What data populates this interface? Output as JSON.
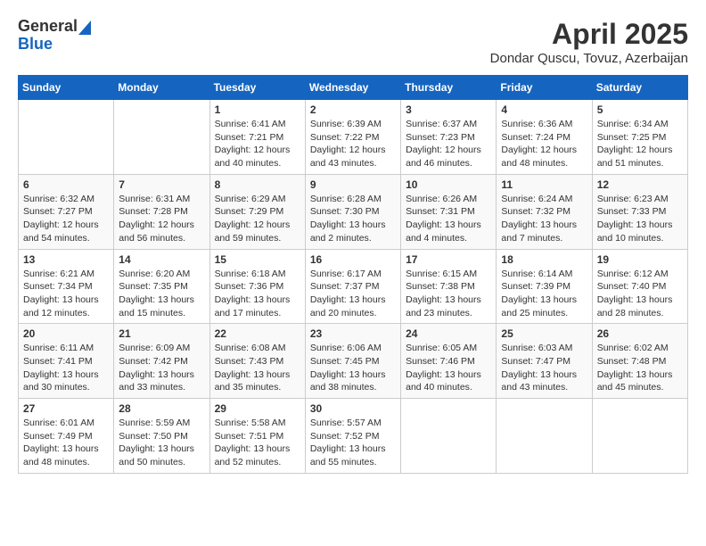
{
  "header": {
    "logo_general": "General",
    "logo_blue": "Blue",
    "title": "April 2025",
    "location": "Dondar Quscu, Tovuz, Azerbaijan"
  },
  "weekdays": [
    "Sunday",
    "Monday",
    "Tuesday",
    "Wednesday",
    "Thursday",
    "Friday",
    "Saturday"
  ],
  "weeks": [
    [
      {
        "date": "",
        "sunrise": "",
        "sunset": "",
        "daylight": ""
      },
      {
        "date": "",
        "sunrise": "",
        "sunset": "",
        "daylight": ""
      },
      {
        "date": "1",
        "sunrise": "Sunrise: 6:41 AM",
        "sunset": "Sunset: 7:21 PM",
        "daylight": "Daylight: 12 hours and 40 minutes."
      },
      {
        "date": "2",
        "sunrise": "Sunrise: 6:39 AM",
        "sunset": "Sunset: 7:22 PM",
        "daylight": "Daylight: 12 hours and 43 minutes."
      },
      {
        "date": "3",
        "sunrise": "Sunrise: 6:37 AM",
        "sunset": "Sunset: 7:23 PM",
        "daylight": "Daylight: 12 hours and 46 minutes."
      },
      {
        "date": "4",
        "sunrise": "Sunrise: 6:36 AM",
        "sunset": "Sunset: 7:24 PM",
        "daylight": "Daylight: 12 hours and 48 minutes."
      },
      {
        "date": "5",
        "sunrise": "Sunrise: 6:34 AM",
        "sunset": "Sunset: 7:25 PM",
        "daylight": "Daylight: 12 hours and 51 minutes."
      }
    ],
    [
      {
        "date": "6",
        "sunrise": "Sunrise: 6:32 AM",
        "sunset": "Sunset: 7:27 PM",
        "daylight": "Daylight: 12 hours and 54 minutes."
      },
      {
        "date": "7",
        "sunrise": "Sunrise: 6:31 AM",
        "sunset": "Sunset: 7:28 PM",
        "daylight": "Daylight: 12 hours and 56 minutes."
      },
      {
        "date": "8",
        "sunrise": "Sunrise: 6:29 AM",
        "sunset": "Sunset: 7:29 PM",
        "daylight": "Daylight: 12 hours and 59 minutes."
      },
      {
        "date": "9",
        "sunrise": "Sunrise: 6:28 AM",
        "sunset": "Sunset: 7:30 PM",
        "daylight": "Daylight: 13 hours and 2 minutes."
      },
      {
        "date": "10",
        "sunrise": "Sunrise: 6:26 AM",
        "sunset": "Sunset: 7:31 PM",
        "daylight": "Daylight: 13 hours and 4 minutes."
      },
      {
        "date": "11",
        "sunrise": "Sunrise: 6:24 AM",
        "sunset": "Sunset: 7:32 PM",
        "daylight": "Daylight: 13 hours and 7 minutes."
      },
      {
        "date": "12",
        "sunrise": "Sunrise: 6:23 AM",
        "sunset": "Sunset: 7:33 PM",
        "daylight": "Daylight: 13 hours and 10 minutes."
      }
    ],
    [
      {
        "date": "13",
        "sunrise": "Sunrise: 6:21 AM",
        "sunset": "Sunset: 7:34 PM",
        "daylight": "Daylight: 13 hours and 12 minutes."
      },
      {
        "date": "14",
        "sunrise": "Sunrise: 6:20 AM",
        "sunset": "Sunset: 7:35 PM",
        "daylight": "Daylight: 13 hours and 15 minutes."
      },
      {
        "date": "15",
        "sunrise": "Sunrise: 6:18 AM",
        "sunset": "Sunset: 7:36 PM",
        "daylight": "Daylight: 13 hours and 17 minutes."
      },
      {
        "date": "16",
        "sunrise": "Sunrise: 6:17 AM",
        "sunset": "Sunset: 7:37 PM",
        "daylight": "Daylight: 13 hours and 20 minutes."
      },
      {
        "date": "17",
        "sunrise": "Sunrise: 6:15 AM",
        "sunset": "Sunset: 7:38 PM",
        "daylight": "Daylight: 13 hours and 23 minutes."
      },
      {
        "date": "18",
        "sunrise": "Sunrise: 6:14 AM",
        "sunset": "Sunset: 7:39 PM",
        "daylight": "Daylight: 13 hours and 25 minutes."
      },
      {
        "date": "19",
        "sunrise": "Sunrise: 6:12 AM",
        "sunset": "Sunset: 7:40 PM",
        "daylight": "Daylight: 13 hours and 28 minutes."
      }
    ],
    [
      {
        "date": "20",
        "sunrise": "Sunrise: 6:11 AM",
        "sunset": "Sunset: 7:41 PM",
        "daylight": "Daylight: 13 hours and 30 minutes."
      },
      {
        "date": "21",
        "sunrise": "Sunrise: 6:09 AM",
        "sunset": "Sunset: 7:42 PM",
        "daylight": "Daylight: 13 hours and 33 minutes."
      },
      {
        "date": "22",
        "sunrise": "Sunrise: 6:08 AM",
        "sunset": "Sunset: 7:43 PM",
        "daylight": "Daylight: 13 hours and 35 minutes."
      },
      {
        "date": "23",
        "sunrise": "Sunrise: 6:06 AM",
        "sunset": "Sunset: 7:45 PM",
        "daylight": "Daylight: 13 hours and 38 minutes."
      },
      {
        "date": "24",
        "sunrise": "Sunrise: 6:05 AM",
        "sunset": "Sunset: 7:46 PM",
        "daylight": "Daylight: 13 hours and 40 minutes."
      },
      {
        "date": "25",
        "sunrise": "Sunrise: 6:03 AM",
        "sunset": "Sunset: 7:47 PM",
        "daylight": "Daylight: 13 hours and 43 minutes."
      },
      {
        "date": "26",
        "sunrise": "Sunrise: 6:02 AM",
        "sunset": "Sunset: 7:48 PM",
        "daylight": "Daylight: 13 hours and 45 minutes."
      }
    ],
    [
      {
        "date": "27",
        "sunrise": "Sunrise: 6:01 AM",
        "sunset": "Sunset: 7:49 PM",
        "daylight": "Daylight: 13 hours and 48 minutes."
      },
      {
        "date": "28",
        "sunrise": "Sunrise: 5:59 AM",
        "sunset": "Sunset: 7:50 PM",
        "daylight": "Daylight: 13 hours and 50 minutes."
      },
      {
        "date": "29",
        "sunrise": "Sunrise: 5:58 AM",
        "sunset": "Sunset: 7:51 PM",
        "daylight": "Daylight: 13 hours and 52 minutes."
      },
      {
        "date": "30",
        "sunrise": "Sunrise: 5:57 AM",
        "sunset": "Sunset: 7:52 PM",
        "daylight": "Daylight: 13 hours and 55 minutes."
      },
      {
        "date": "",
        "sunrise": "",
        "sunset": "",
        "daylight": ""
      },
      {
        "date": "",
        "sunrise": "",
        "sunset": "",
        "daylight": ""
      },
      {
        "date": "",
        "sunrise": "",
        "sunset": "",
        "daylight": ""
      }
    ]
  ]
}
